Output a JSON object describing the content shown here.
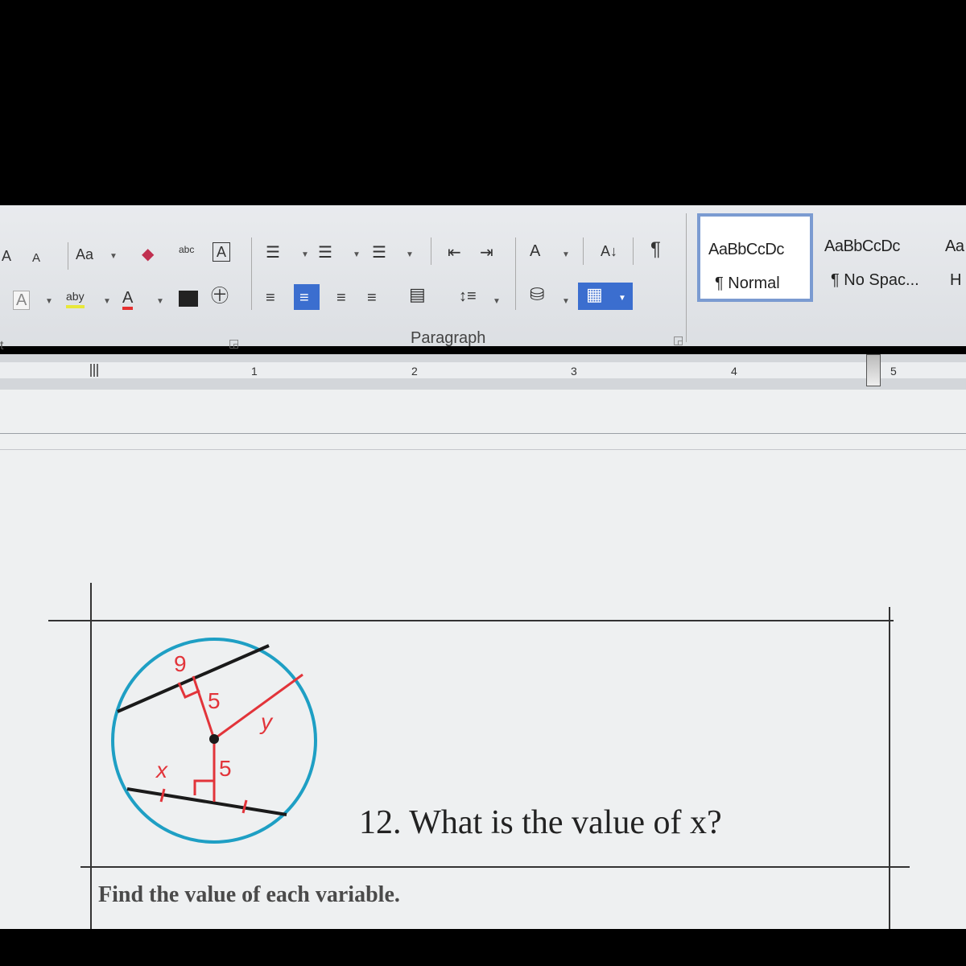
{
  "ribbon": {
    "font_row1": {
      "shrink": "A",
      "grow": "A",
      "case": "Aa",
      "clear": "abc",
      "char_border": "A"
    },
    "font_row2": {
      "font_color": "A",
      "highlight": "aby",
      "text_color": "A"
    },
    "paragraph_label": "Paragraph",
    "sort_label": "A↓",
    "pilcrow": "¶",
    "styles": [
      {
        "sample": "AaBbCcDc",
        "name": "¶ Normal"
      },
      {
        "sample": "AaBbCcDc",
        "name": "¶ No Spac..."
      },
      {
        "sample": "Aa",
        "name": "H"
      }
    ]
  },
  "ruler": {
    "numbers": [
      "1",
      "2",
      "3",
      "4",
      "5"
    ]
  },
  "document": {
    "diagram_labels": {
      "top_chord": "9",
      "top_dist": "5",
      "bottom_dist": "5",
      "right_label": "y",
      "bottom_label": "x"
    },
    "question": "12. What is the value of x?",
    "instruction": "Find the value of each variable."
  },
  "colors": {
    "circle": "#1e9fc4",
    "red_segments": "#e2343a",
    "chord": "#1a1a1a",
    "ribbon_bg": "#e4e6e9",
    "selected": "#3b6ecf"
  }
}
